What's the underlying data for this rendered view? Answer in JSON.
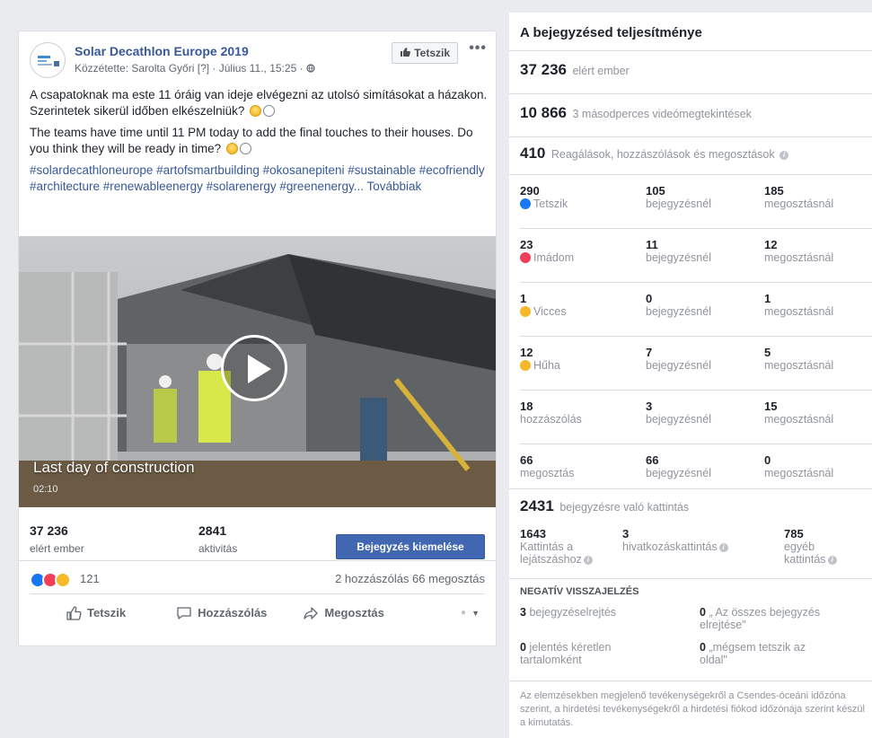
{
  "post": {
    "page_name": "Solar Decathlon Europe 2019",
    "meta": "Közzétette: Sarolta Győri [?] · Július 11., 15:25 ·",
    "like_page_label": "Tetszik",
    "more_label": "•••",
    "text_hu": "A csapatoknak ma este 11 óráig van ideje elvégezni az utolsó simításokat a házakon. Szerintetek sikerül időben elkészelniük?",
    "text_en": "The teams have time until 11 PM today to add the final touches to their houses. Do you think they will be ready in time?",
    "hashtags": "#solardecathloneurope #artofsmartbuilding #okosanepiteni #sustainable #ecofriendly #architecture #renewableenergy #solarenergy #greenenergy... Továbbiak",
    "video": {
      "title": "Last day of construction",
      "duration": "02:10"
    },
    "stats": {
      "reach_num": "37 236",
      "reach_label": "elért ember",
      "activity_num": "2841",
      "activity_label": "aktivitás",
      "boost_label": "Bejegyzés kiemelése"
    },
    "reactions": {
      "count": "121",
      "summary": "2 hozzászólás 66 megosztás"
    },
    "actions": {
      "like": "Tetszik",
      "comment": "Hozzászólás",
      "share": "Megosztás"
    }
  },
  "insights": {
    "title": "A bejegyzésed teljesítménye",
    "reach": {
      "num": "37 236",
      "label": "elért ember"
    },
    "views": {
      "num": "10 866",
      "label": "3 másodperces videómegtekintések"
    },
    "engagement": {
      "num": "410",
      "label": "Reagálások, hozzászólások és megosztások"
    },
    "rows": [
      {
        "total": "290",
        "label": "Tetszik",
        "icon": "like",
        "post": "105",
        "shares": "185"
      },
      {
        "total": "23",
        "label": "Imádom",
        "icon": "love",
        "post": "11",
        "shares": "12"
      },
      {
        "total": "1",
        "label": "Vicces",
        "icon": "haha",
        "post": "0",
        "shares": "1"
      },
      {
        "total": "12",
        "label": "Hűha",
        "icon": "wow",
        "post": "7",
        "shares": "5"
      },
      {
        "total": "18",
        "label": "hozzászólás",
        "icon": "",
        "post": "3",
        "shares": "15"
      },
      {
        "total": "66",
        "label": "megosztás",
        "icon": "",
        "post": "66",
        "shares": "0"
      }
    ],
    "col_post_label": "bejegyzésnél",
    "col_shares_label": "megosztásnál",
    "clicks": {
      "num": "2431",
      "label": "bejegyzésre való kattintás"
    },
    "click_breakdown": {
      "play_num": "1643",
      "play_label_1": "Kattintás a",
      "play_label_2": "lejátszáshoz",
      "link_num": "3",
      "link_label": "hivatkozáskattintás",
      "other_num": "785",
      "other_label_1": "egyéb",
      "other_label_2": "kattintás"
    },
    "negative": {
      "title": "NEGATÍV VISSZAJELZÉS",
      "hide_num": "3",
      "hide_label": "bejegyzéselrejtés",
      "hide_all_num": "0",
      "hide_all_label_1": "„ Az összes bejegyzés",
      "hide_all_label_2": "elrejtése\"",
      "spam_num": "0",
      "spam_label_1": "jelentés kéretlen",
      "spam_label_2": "tartalomként",
      "unlike_num": "0",
      "unlike_label_1": "„mégsem tetszik az",
      "unlike_label_2": "oldal\""
    },
    "footnote": "Az elemzésekben megjelenő tevékenységekről a Csendes-óceáni időzóna szerint, a hirdetési tevékenységekről a hirdetési fiókod időzónája szerint készül a kimutatás."
  }
}
